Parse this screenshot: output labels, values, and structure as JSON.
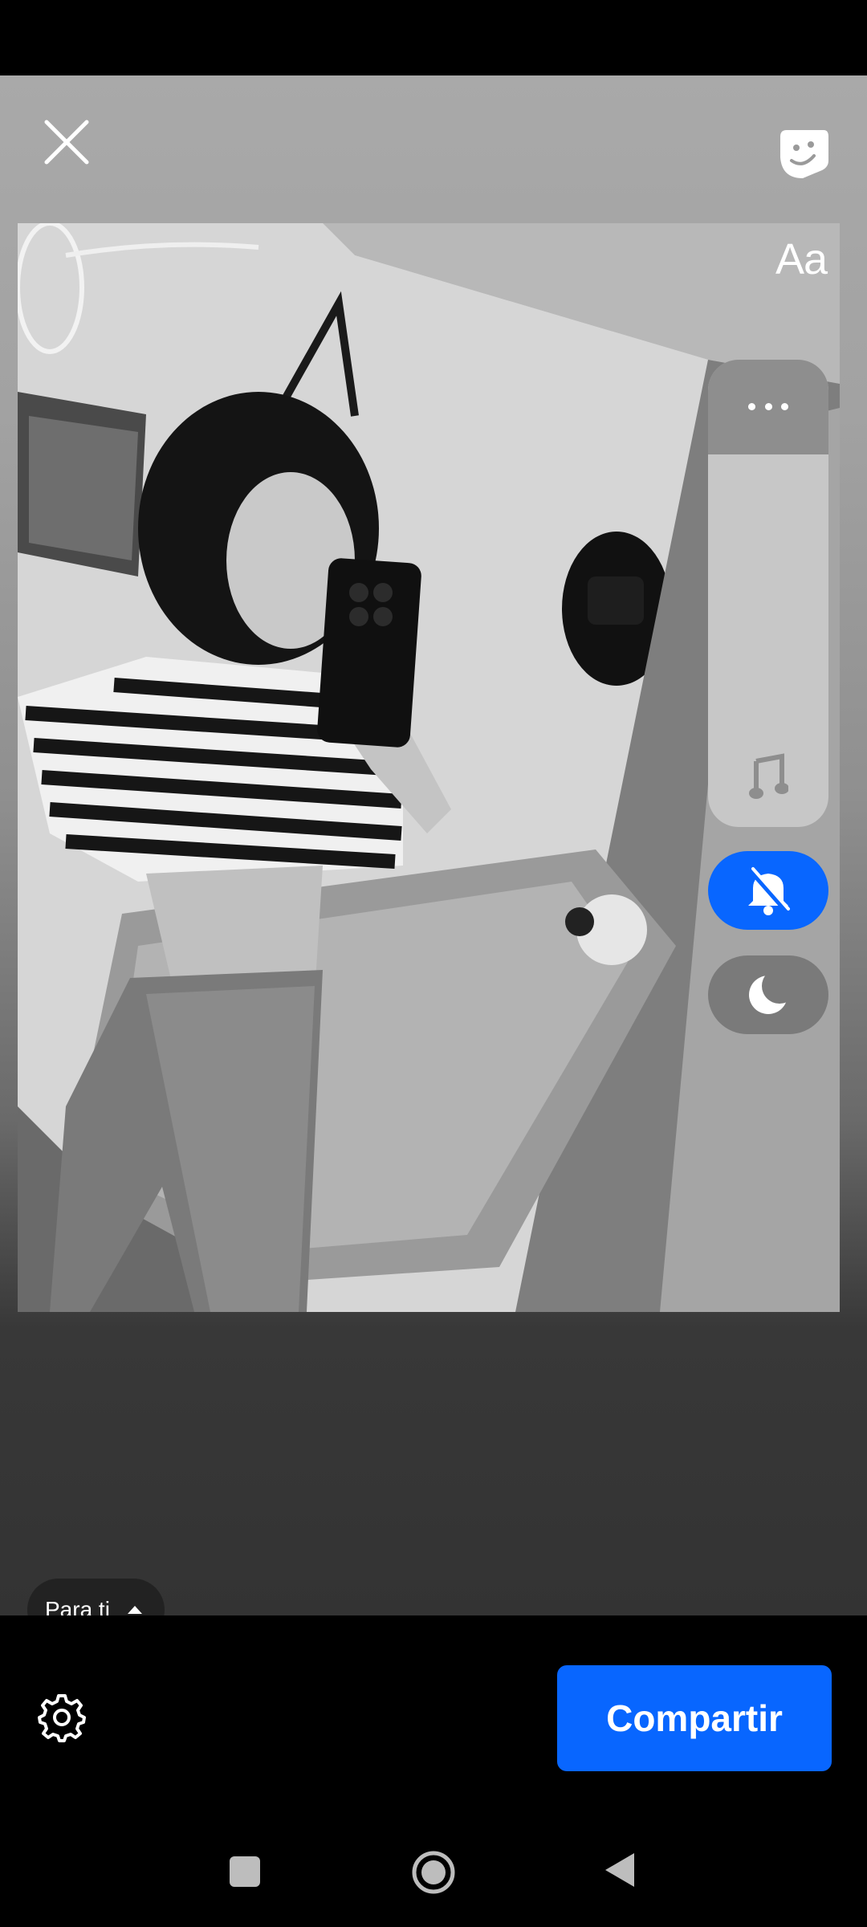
{
  "editor": {
    "close_icon": "close-icon",
    "sticker_icon": "sticker-icon",
    "text_tool_label": "Aa",
    "tools_panel": {
      "more_icon": "more-horizontal-icon",
      "music_icon": "music-note-icon"
    },
    "mute_icon": "bell-off-icon",
    "night_icon": "moon-icon",
    "photo": "story-photo"
  },
  "audience": {
    "label": "Para ti",
    "icon": "caret-up-icon"
  },
  "footer": {
    "settings_icon": "gear-icon",
    "share_label": "Compartir"
  },
  "navigation": {
    "recents_icon": "square-icon",
    "home_icon": "circle-icon",
    "back_icon": "triangle-back-icon"
  },
  "colors": {
    "accent": "#0866FF",
    "panel": "#C7C7C7",
    "background_dark": "#333333"
  }
}
